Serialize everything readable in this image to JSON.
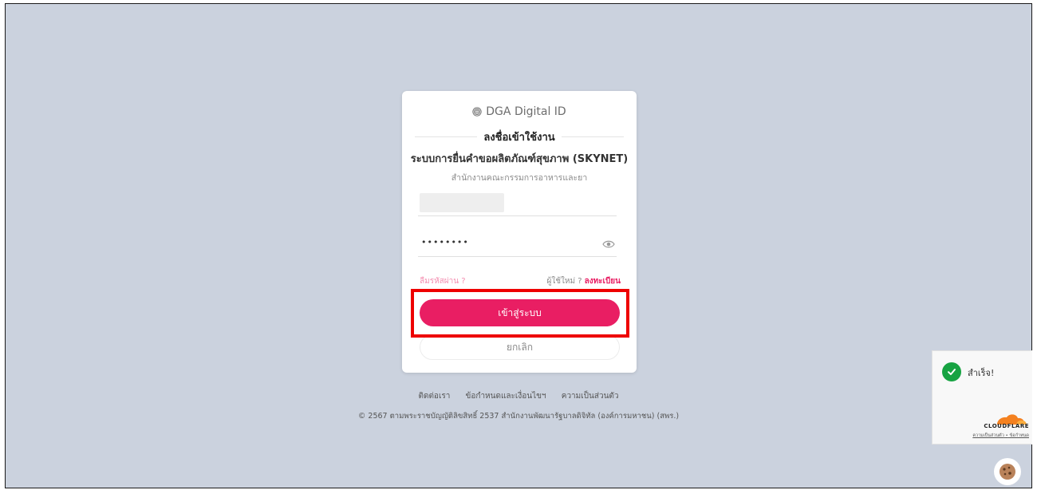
{
  "brand": {
    "name": "DGA Digital ID",
    "icon": "fingerprint-icon"
  },
  "login": {
    "heading": "ลงชื่อเข้าใช้งาน",
    "system_title": "ระบบการยื่นคำขอผลิตภัณฑ์สุขภาพ (SKYNET)",
    "organization": "สำนักงานคณะกรรมการอาหารและยา",
    "password_value": "••••••••",
    "forgot_password": "ลืมรหัสผ่าน ?",
    "new_user": "ผู้ใช้ใหม่ ?",
    "register": "ลงทะเบียน",
    "login_button": "เข้าสู่ระบบ",
    "cancel_button": "ยกเลิก"
  },
  "footer": {
    "links": [
      "ติดต่อเรา",
      "ข้อกำหนดและเงื่อนไขฯ",
      "ความเป็นส่วนตัว"
    ],
    "copyright": "© 2567 ตามพระราชบัญญัติลิขสิทธิ์ 2537 สำนักงานพัฒนารัฐบาลดิจิทัล (องค์การมหาชน) (สพร.)"
  },
  "cloudflare": {
    "status": "สำเร็จ!",
    "brand": "CLOUDFLARE",
    "privacy": "ความเป็นส่วนตัว",
    "separator": "•",
    "terms": "ข้อกำหนด"
  },
  "colors": {
    "background": "#cbd2de",
    "accent": "#e91e63",
    "highlight": "#ee0000",
    "success": "#17a342",
    "cloudflare_orange": "#f48120"
  }
}
